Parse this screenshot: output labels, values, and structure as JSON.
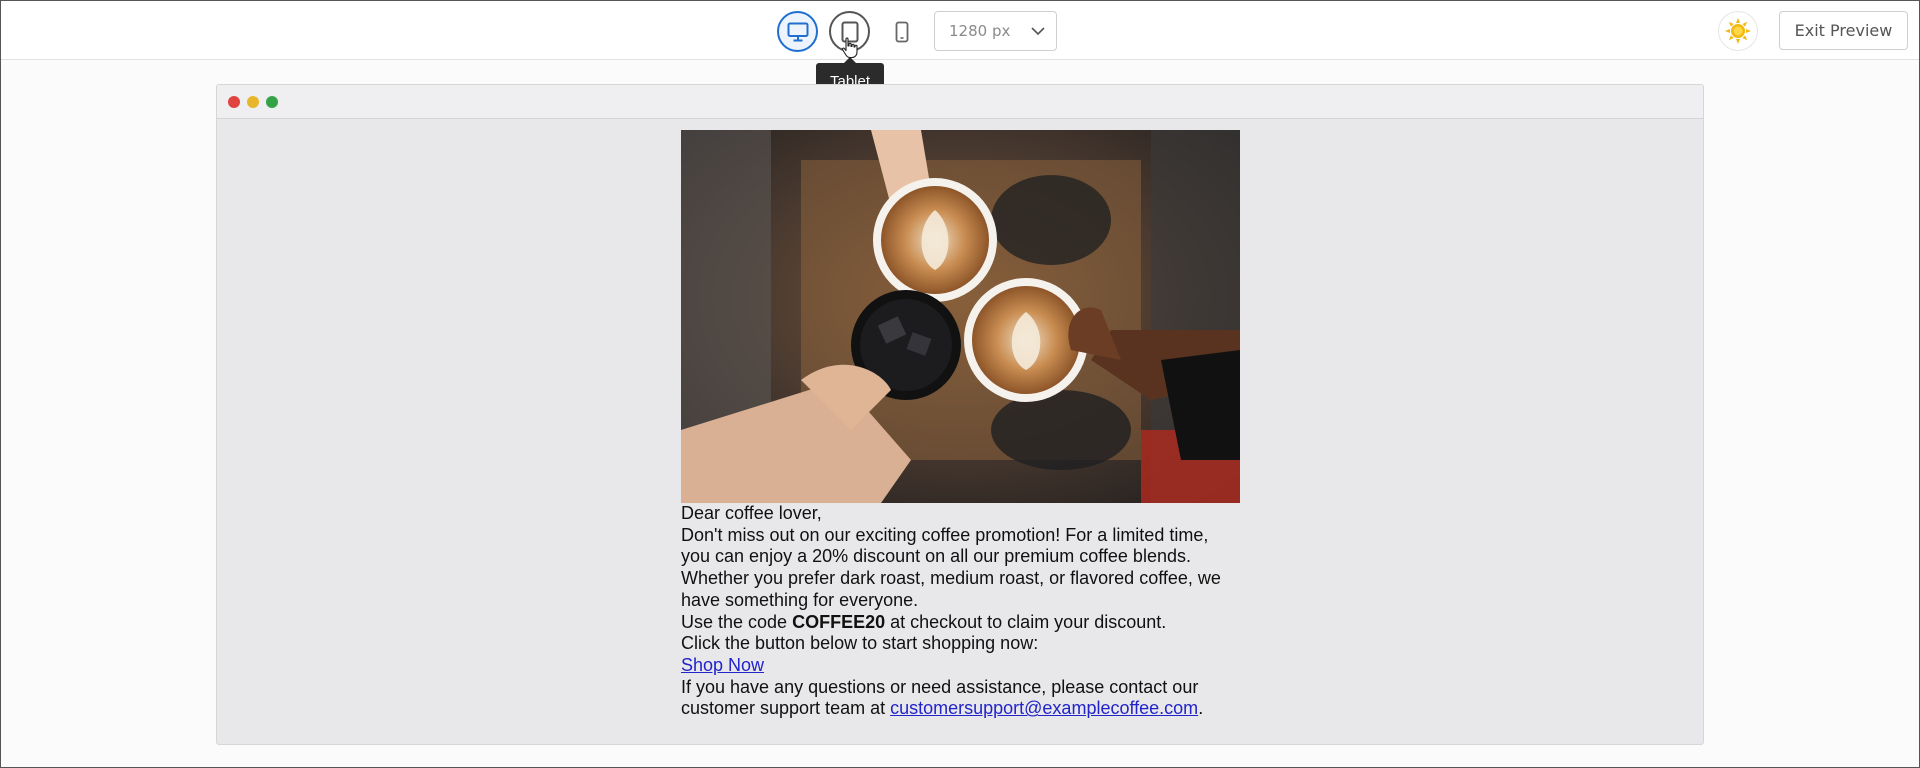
{
  "toolbar": {
    "devices": [
      {
        "name": "desktop",
        "icon": "desktop-monitor-icon",
        "active": true
      },
      {
        "name": "tablet",
        "icon": "tablet-icon",
        "active": false,
        "hovered": true
      },
      {
        "name": "mobile",
        "icon": "mobile-phone-icon",
        "active": false
      }
    ],
    "width_select": {
      "value": "1280 px"
    },
    "tooltip": "Tablet",
    "theme_icon": "sun-icon",
    "exit_label": "Exit Preview"
  },
  "colors": {
    "accent": "#1f6fd1",
    "link": "#2223c9",
    "sun": "#f2b90f",
    "tooltip_bg": "#2b2b2b"
  },
  "email": {
    "greeting": "Dear coffee lover,",
    "promo": "Don't miss out on our exciting coffee promotion! For a limited time, you can enjoy a 20% discount on all our premium coffee blends. Whether you prefer dark roast, medium roast, or flavored coffee, we have something for everyone.",
    "code_before": "Use the code ",
    "code": "COFFEE20",
    "code_after": " at checkout to claim your discount.",
    "cta_intro": "Click the button below to start shopping now:",
    "cta_link": "Shop Now",
    "support_before": "If you have any questions or need assistance, please contact our customer support team at ",
    "support_email": "customersupport@examplecoffee.com",
    "support_after": "."
  }
}
